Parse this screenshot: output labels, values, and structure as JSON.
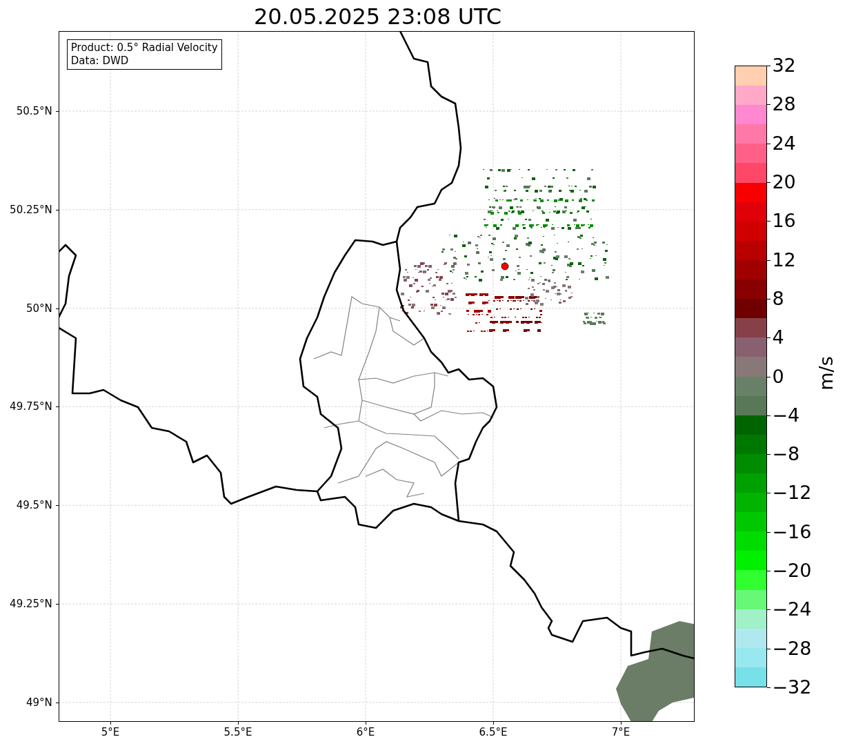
{
  "title": "20.05.2025 23:08 UTC",
  "info_box": {
    "lines": [
      "Product: 0.5° Radial Velocity",
      "Data: DWD"
    ]
  },
  "map": {
    "y_ticks": [
      "50.5°N",
      "50.25°N",
      "50°N",
      "49.75°N",
      "49.5°N",
      "49.25°N",
      "49°N"
    ],
    "x_ticks": [
      "5°E",
      "5.5°E",
      "6°E",
      "6.5°E",
      "7°E"
    ]
  },
  "colorbar": {
    "label": "m/s",
    "ticks": [
      "32",
      "28",
      "24",
      "20",
      "16",
      "12",
      "8",
      "4",
      "0",
      "−4",
      "−8",
      "−12",
      "−16",
      "−20",
      "−24",
      "−28",
      "−32"
    ],
    "segments": [
      {
        "color": "#ffcfb0"
      },
      {
        "color": "#ffa8c8"
      },
      {
        "color": "#ff88d0"
      },
      {
        "color": "#ff78a8"
      },
      {
        "color": "#ff6088"
      },
      {
        "color": "#ff4868"
      },
      {
        "color": "#f80000"
      },
      {
        "color": "#e00008"
      },
      {
        "color": "#d00000"
      },
      {
        "color": "#b80000"
      },
      {
        "color": "#a00000"
      },
      {
        "color": "#880000"
      },
      {
        "color": "#700000"
      },
      {
        "color": "#884048"
      },
      {
        "color": "#886070"
      },
      {
        "color": "#887878"
      },
      {
        "color": "#688068"
      },
      {
        "color": "#587858"
      },
      {
        "color": "#006400"
      },
      {
        "color": "#007800"
      },
      {
        "color": "#008c00"
      },
      {
        "color": "#00a000"
      },
      {
        "color": "#00b400"
      },
      {
        "color": "#00c800"
      },
      {
        "color": "#00dc00"
      },
      {
        "color": "#00f000"
      },
      {
        "color": "#30ff30"
      },
      {
        "color": "#68f878"
      },
      {
        "color": "#a0f0c8"
      },
      {
        "color": "#b0e8f0"
      },
      {
        "color": "#98e8f0"
      },
      {
        "color": "#78e0e8"
      }
    ]
  }
}
